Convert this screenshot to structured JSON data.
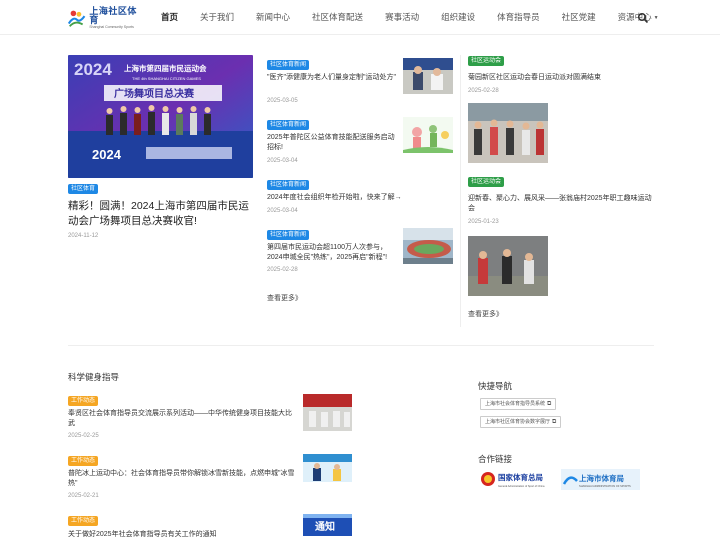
{
  "header": {
    "logo_cn": "上海社区体育",
    "logo_en": "Shanghai Community Sports",
    "nav": [
      "首页",
      "关于我们",
      "新闻中心",
      "社区体育配送",
      "赛事活动",
      "组织建设",
      "体育指导员",
      "社区党建",
      "资源中心"
    ]
  },
  "hero": {
    "image_text": {
      "year": "2024",
      "title_cn": "上海市第四届市民运动会",
      "title_en": "THE 4th SHANGHAI CITIZEN GAMES",
      "subtitle": "广场舞项目总决赛",
      "banner_year": "2024"
    },
    "tag": "社区体育",
    "title": "精彩！圆满！2024上海市第四届市民运动会广场舞项目总决赛收官!",
    "date": "2024-11-12"
  },
  "news_col": {
    "items": [
      {
        "tag": "社区体育新闻",
        "title": "\"医齐\"添健康为老人们量身定制\"运动处方\"",
        "date": "2025-03-05"
      },
      {
        "tag": "社区体育新闻",
        "title": "2025年普陀区公益体育技能配送服务启动招标!",
        "date": "2025-03-04"
      },
      {
        "tag": "社区体育新闻",
        "title": "2024年度社会组织年检开始啦，快来了解→",
        "date": "2025-03-04"
      },
      {
        "tag": "社区体育新闻",
        "title": "第四届市民运动会超1100万人次参与，2024申城全民\"热练\"，2025再启\"新程\"!",
        "date": "2025-02-28"
      }
    ],
    "more": "查看更多》"
  },
  "activity_col": {
    "items": [
      {
        "tag": "社区运动会",
        "title": "菊园新区社区运动会春日运动派对圆满结束",
        "date": "2025-02-28"
      },
      {
        "tag": "社区运动会",
        "title": "迎新春、聚心力、展风采——张翁庙村2025年职工趣味运动会",
        "date": "2025-01-23"
      }
    ],
    "more": "查看更多》"
  },
  "guide": {
    "title": "科学健身指导",
    "items": [
      {
        "tag": "工作动态",
        "title": "奉贤区社会体育指导员交流展示系列活动——中华传统健身项目技能大比武",
        "date": "2025-02-25"
      },
      {
        "tag": "工作动态",
        "title": "普陀冰上运动中心：社会体育指导员带你解锁冰雪新技能，点燃申城\"冰雪热\"",
        "date": "2025-02-21"
      },
      {
        "tag": "工作动态",
        "title": "关于做好2025年社会体育指导员有关工作的通知",
        "thumb_text": "通知"
      }
    ]
  },
  "quick_links": {
    "title": "快捷导航",
    "items": [
      "上海市社会体育指导员系统",
      "上海市社区体育协会数字展厅"
    ]
  },
  "partners": {
    "title": "合作链接",
    "items": [
      {
        "name": "国家体育总局",
        "sub": "General Administration of Sport of China"
      },
      {
        "name": "上海市体育局",
        "sub": "SHANGHAI ADMINISTRATION OF SPORTS"
      }
    ]
  },
  "colors": {
    "brand": "#1f4f9c",
    "news_tag": "#1e88e5",
    "activity_tag": "#2e9e48",
    "guide_tag": "#f5a623"
  }
}
